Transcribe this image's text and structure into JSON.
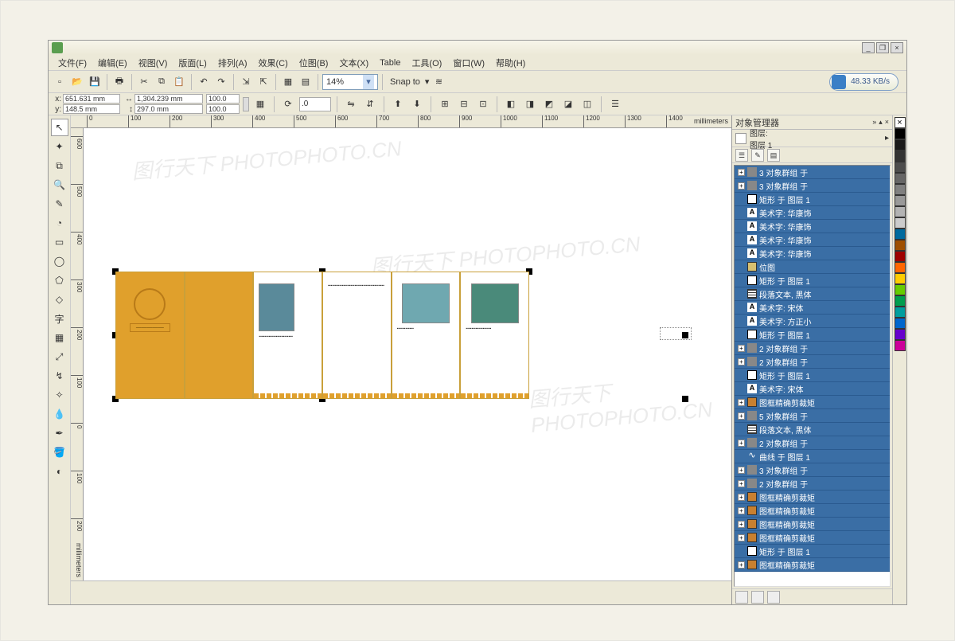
{
  "menu": {
    "file": "文件(F)",
    "edit": "编辑(E)",
    "view": "视图(V)",
    "layout": "版面(L)",
    "arrange": "排列(A)",
    "effect": "效果(C)",
    "bitmap": "位图(B)",
    "text": "文本(X)",
    "table": "Table",
    "tools": "工具(O)",
    "window": "窗口(W)",
    "help": "帮助(H)"
  },
  "toolbar": {
    "zoom": "14%",
    "snap": "Snap to",
    "speed": "48.33 KB/s"
  },
  "props": {
    "x": "651.631 mm",
    "y": "148.5 mm",
    "w": "1,304.239 mm",
    "h": "297.0 mm",
    "sx": "100.0",
    "sy": "100.0",
    "angle": ".0"
  },
  "ruler": {
    "h": [
      "0",
      "100",
      "200",
      "300",
      "400",
      "500",
      "600",
      "700",
      "800",
      "900",
      "1000",
      "1100",
      "1200",
      "1300",
      "1400"
    ],
    "unit": "millimeters",
    "v": [
      "600",
      "500",
      "400",
      "300",
      "200",
      "100",
      "0",
      "100",
      "200"
    ]
  },
  "docker": {
    "title": "对象管理器",
    "layer_lbl": "图层:",
    "layer_name": "图层 1"
  },
  "objects": [
    {
      "t": "grp",
      "e": "+",
      "l": "3 对象群组 于"
    },
    {
      "t": "grp",
      "e": "+",
      "l": "3 对象群组 于"
    },
    {
      "t": "rect",
      "l": "矩形 于 图层 1"
    },
    {
      "t": "txt",
      "l": "美术字: 华康饰"
    },
    {
      "t": "txt",
      "l": "美术字: 华康饰"
    },
    {
      "t": "txt",
      "l": "美术字: 华康饰"
    },
    {
      "t": "txt",
      "l": "美术字: 华康饰"
    },
    {
      "t": "img",
      "l": "位图"
    },
    {
      "t": "rect",
      "l": "矩形 于 图层 1"
    },
    {
      "t": "para",
      "l": "段落文本, 黑体"
    },
    {
      "t": "txt",
      "l": "美术字: 宋体"
    },
    {
      "t": "txt",
      "l": "美术字: 方正小"
    },
    {
      "t": "rect",
      "l": "矩形 于 图层 1"
    },
    {
      "t": "grp",
      "e": "+",
      "l": "2 对象群组 于"
    },
    {
      "t": "grp",
      "e": "+",
      "l": "2 对象群组 于"
    },
    {
      "t": "rect",
      "l": "矩形 于 图层 1"
    },
    {
      "t": "txt",
      "l": "美术字: 宋体"
    },
    {
      "t": "clip",
      "e": "+",
      "l": "图框精确剪裁矩"
    },
    {
      "t": "grp",
      "e": "+",
      "l": "5 对象群组 于"
    },
    {
      "t": "para",
      "l": "段落文本, 黑体"
    },
    {
      "t": "grp",
      "e": "+",
      "l": "2 对象群组 于"
    },
    {
      "t": "crv",
      "l": "曲线 于 图层 1"
    },
    {
      "t": "grp",
      "e": "+",
      "l": "3 对象群组 于"
    },
    {
      "t": "grp",
      "e": "+",
      "l": "2 对象群组 于"
    },
    {
      "t": "clip",
      "e": "+",
      "l": "图框精确剪裁矩"
    },
    {
      "t": "clip",
      "e": "+",
      "l": "图框精确剪裁矩"
    },
    {
      "t": "clip",
      "e": "+",
      "l": "图框精确剪裁矩"
    },
    {
      "t": "clip",
      "e": "+",
      "l": "图框精确剪裁矩"
    },
    {
      "t": "rect",
      "l": "矩形 于 图层 1"
    },
    {
      "t": "clip",
      "e": "+",
      "l": "图框精确剪裁矩"
    }
  ],
  "palette": [
    "#000000",
    "#1a1a1a",
    "#333333",
    "#4d4d4d",
    "#666666",
    "#808080",
    "#999999",
    "#b3b3b3",
    "#cccccc",
    "#006a9e",
    "#9e4f00",
    "#9e0000",
    "#ff6600",
    "#ffcc00",
    "#66cc00",
    "#009e4f",
    "#009e9e",
    "#0066cc",
    "#6600cc",
    "#cc0099"
  ],
  "watermark": "图行天下  PHOTOPHOTO.CN"
}
